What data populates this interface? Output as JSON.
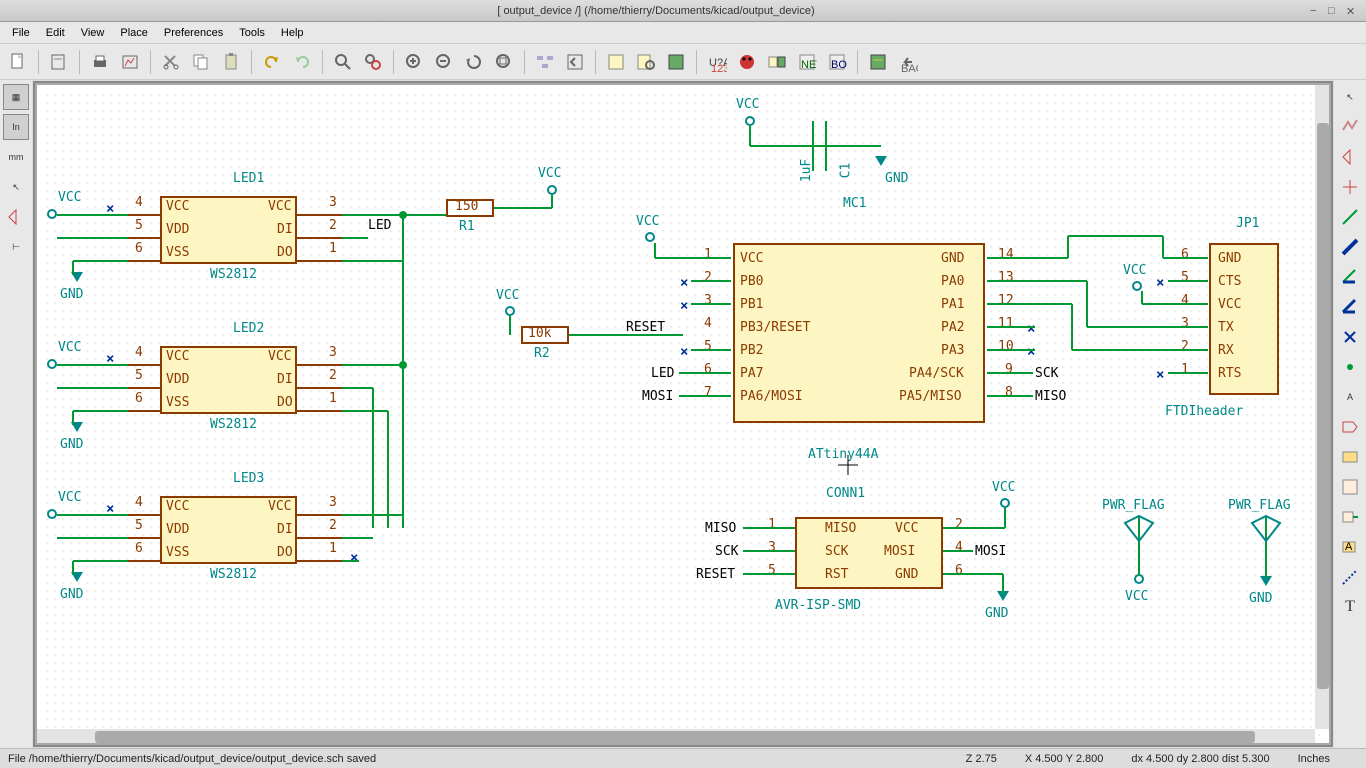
{
  "title": "[ output_device /] (/home/thierry/Documents/kicad/output_device)",
  "menu": {
    "file": "File",
    "edit": "Edit",
    "view": "View",
    "place": "Place",
    "prefs": "Preferences",
    "tools": "Tools",
    "help": "Help"
  },
  "units": {
    "in": "In",
    "mm": "mm"
  },
  "footer": {
    "status": "File /home/thierry/Documents/kicad/output_device/output_device.sch saved",
    "zoom": "Z 2.75",
    "xy": "X 4.500  Y 2.800",
    "dxy": "dx 4.500  dy 2.800  dist 5.300",
    "units": "Inches"
  },
  "components": {
    "led1": {
      "ref": "LED1",
      "type": "WS2812",
      "pins_left": [
        "VCC",
        "VDD",
        "VSS"
      ],
      "pins_left_nums": [
        "4",
        "5",
        "6"
      ],
      "pins_right": [
        "VCC",
        "DI",
        "DO"
      ],
      "pins_right_nums": [
        "3",
        "2",
        "1"
      ],
      "label": "LED"
    },
    "led2": {
      "ref": "LED2",
      "type": "WS2812",
      "pins_left": [
        "VCC",
        "VDD",
        "VSS"
      ],
      "pins_left_nums": [
        "4",
        "5",
        "6"
      ],
      "pins_right": [
        "VCC",
        "DI",
        "DO"
      ],
      "pins_right_nums": [
        "3",
        "2",
        "1"
      ]
    },
    "led3": {
      "ref": "LED3",
      "type": "WS2812",
      "pins_left": [
        "VCC",
        "VDD",
        "VSS"
      ],
      "pins_left_nums": [
        "4",
        "5",
        "6"
      ],
      "pins_right": [
        "VCC",
        "DI",
        "DO"
      ],
      "pins_right_nums": [
        "3",
        "2",
        "1"
      ]
    },
    "r1": {
      "ref": "R1",
      "value": "150"
    },
    "r2": {
      "ref": "R2",
      "value": "10k"
    },
    "c1": {
      "ref": "C1",
      "value": "1uF"
    },
    "mc1": {
      "ref": "MC1",
      "type": "ATtiny44A",
      "left": [
        "VCC",
        "PB0",
        "PB1",
        "PB3/RESET",
        "PB2",
        "PA7",
        "PA6/MOSI"
      ],
      "left_nums": [
        "1",
        "2",
        "3",
        "4",
        "5",
        "6",
        "7"
      ],
      "right": [
        "GND",
        "PA0",
        "PA1",
        "PA2",
        "PA3",
        "PA4/SCK",
        "PA5/MISO"
      ],
      "right_nums": [
        "14",
        "13",
        "12",
        "11",
        "10",
        "9",
        "8"
      ],
      "left_labels": {
        "3": "RESET",
        "5": "LED",
        "6": "MOSI"
      },
      "right_labels": {
        "8": "SCK",
        "7": "MISO"
      }
    },
    "jp1": {
      "ref": "JP1",
      "type": "FTDIheader",
      "pins": [
        "GND",
        "CTS",
        "VCC",
        "TX",
        "RX",
        "RTS"
      ],
      "pins_nums": [
        "6",
        "5",
        "4",
        "3",
        "2",
        "1"
      ]
    },
    "conn1": {
      "ref": "CONN1",
      "type": "AVR-ISP-SMD",
      "left": [
        "MISO",
        "SCK",
        "RST"
      ],
      "left_nums": [
        "1",
        "3",
        "5"
      ],
      "right": [
        "VCC",
        "MOSI",
        "GND"
      ],
      "right_nums": [
        "2",
        "4",
        "6"
      ],
      "left_labels": {
        "0": "MISO",
        "1": "SCK",
        "2": "RESET"
      },
      "right_labels": {
        "1": "MOSI"
      }
    },
    "pwr": {
      "flag": "PWR_FLAG",
      "vcc": "VCC",
      "gnd": "GND"
    }
  }
}
